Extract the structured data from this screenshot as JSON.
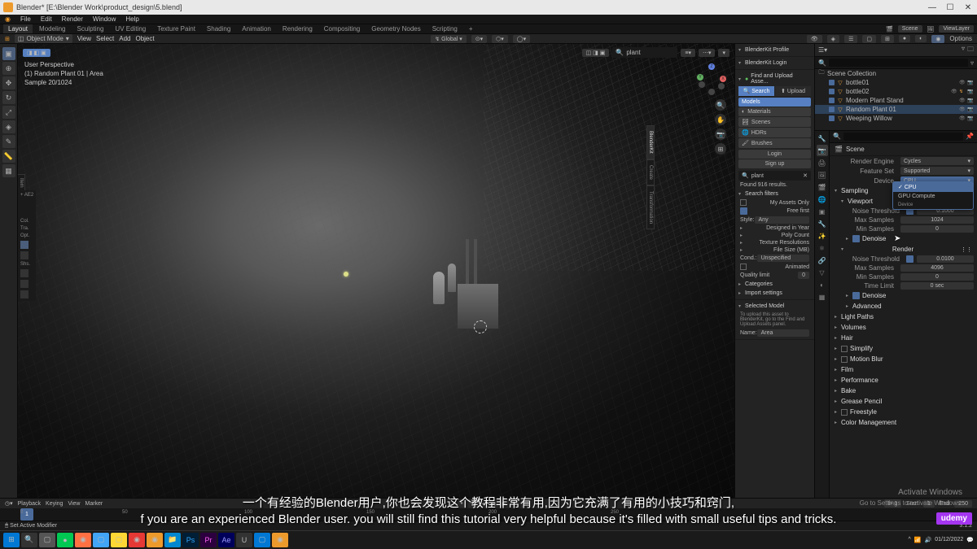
{
  "titlebar": {
    "title": "Blender* [E:\\Blender Work\\product_design\\5.blend]"
  },
  "menubar": {
    "items": [
      "File",
      "Edit",
      "Render",
      "Window",
      "Help"
    ]
  },
  "workspaces": {
    "tabs": [
      "Layout",
      "Modeling",
      "Sculpting",
      "UV Editing",
      "Texture Paint",
      "Shading",
      "Animation",
      "Rendering",
      "Compositing",
      "Geometry Nodes",
      "Scripting"
    ],
    "active": 0,
    "plus": "+"
  },
  "topright": {
    "scene_label": "Scene",
    "viewlayer_label": "ViewLayer"
  },
  "header3d": {
    "mode": "Object Mode",
    "menus": [
      "View",
      "Select",
      "Add",
      "Object"
    ],
    "orientation": "Global",
    "snap": "⬡",
    "options": "Options"
  },
  "viewport_header": {
    "left_pills": [
      "View",
      "Select"
    ],
    "search_val": "plant",
    "filter_icons": [
      "≡",
      "⋯",
      "▾"
    ]
  },
  "viewport_info": {
    "line1": "User Perspective",
    "line2": "(1) Random Plant 01 | Area",
    "line3": "Sample 20/1024"
  },
  "gizmo": {
    "axes": [
      "X",
      "Y",
      "Z"
    ]
  },
  "left_side_tabs": [
    "Item",
    "Tool",
    "View"
  ],
  "blenderkit": {
    "panels": {
      "profile": "BlenderKit Profile",
      "login": "BlenderKit Login",
      "find_upload": "Find and Upload Asse..."
    },
    "search_upload": {
      "search": "Search",
      "upload": "Upload"
    },
    "categories": [
      "Models",
      "Materials",
      "Scenes",
      "HDRs",
      "Brushes"
    ],
    "auth": {
      "login": "Login",
      "signup": "Sign up"
    },
    "search_value": "plant",
    "found": "Found 916 results.",
    "filters_head": "Search filters",
    "filters": {
      "my_assets": "My Assets Only",
      "free_first": "Free first",
      "style": "Style:",
      "style_val": "Any",
      "designed": "Designed in Year",
      "poly": "Poly Count",
      "texres": "Texture Resolutions",
      "filesize": "File Size (MB)",
      "cond": "Cond.:",
      "cond_val": "Unspecified",
      "animated": "Animated",
      "quality": "Quality limit",
      "quality_val": "0"
    },
    "cat_head": "Categories",
    "import_head": "Import settings",
    "selected_head": "Selected Model",
    "selected_info": {
      "line1": "To upload this asset to",
      "line2": "BlenderKit, go to the Find and",
      "line3": "Upload Assets panel.",
      "name_label": "Name:",
      "name_val": "Area"
    },
    "side_tabs": [
      "BlenderKit",
      "Create",
      "Transformation"
    ]
  },
  "outliner": {
    "collection": "Scene Collection",
    "items": [
      {
        "name": "bottle01",
        "selected": false
      },
      {
        "name": "bottle02",
        "selected": false
      },
      {
        "name": "Modern Plant Stand",
        "selected": false
      },
      {
        "name": "Random Plant 01",
        "selected": true
      },
      {
        "name": "Weeping Willow",
        "selected": false
      }
    ]
  },
  "properties": {
    "crumb": "Scene",
    "engine_label": "Render Engine",
    "engine_val": "Cycles",
    "feature_label": "Feature Set",
    "feature_val": "Supported",
    "device_label": "Device",
    "device_val": "CPU",
    "device_popup": {
      "opt1": "CPU",
      "opt2": "GPU Compute",
      "info_label": "Device"
    },
    "sampling": "Sampling",
    "viewport_sec": "Viewport",
    "noise_th": "Noise Threshold",
    "noise_val1": "0.1000",
    "max_samples": "Max Samples",
    "max_val1": "1024",
    "min_samples": "Min Samples",
    "min_val1": "0",
    "denoise1": "Denoise",
    "render_sec": "Render",
    "noise_val2": "0.0100",
    "max_val2": "4096",
    "min_val2": "0",
    "time_limit": "Time Limit",
    "time_val": "0 sec",
    "denoise2": "Denoise",
    "advanced": "Advanced",
    "collapsed": [
      "Light Paths",
      "Volumes",
      "Hair",
      "Simplify",
      "Motion Blur",
      "Film",
      "Performance",
      "Bake",
      "Grease Pencil",
      "Freestyle",
      "Color Management"
    ]
  },
  "timeline": {
    "labels": [
      "Playback",
      "Keying",
      "View",
      "Marker"
    ],
    "start_label": "Start",
    "start_val": "1",
    "end_label": "End",
    "end_val": "250",
    "cur_frame": "1",
    "ticks": [
      "0",
      "50",
      "100",
      "150",
      "200",
      "250"
    ]
  },
  "statusbar": {
    "left1": "Set Active Modifier",
    "right": "3.1.2"
  },
  "activate": {
    "line1": "Activate Windows",
    "line2": "Go to Settings to activate Windows."
  },
  "subtitles": {
    "cn": "一个有经验的Blender用户,你也会发现这个教程非常有用,因为它充满了有用的小技巧和窍门,",
    "en": "f you are an experienced Blender user. you will still find this tutorial very helpful because it's filled with small useful tips and tricks."
  },
  "watermark": "udemy",
  "taskbar": {
    "time": "01/12/2022"
  }
}
